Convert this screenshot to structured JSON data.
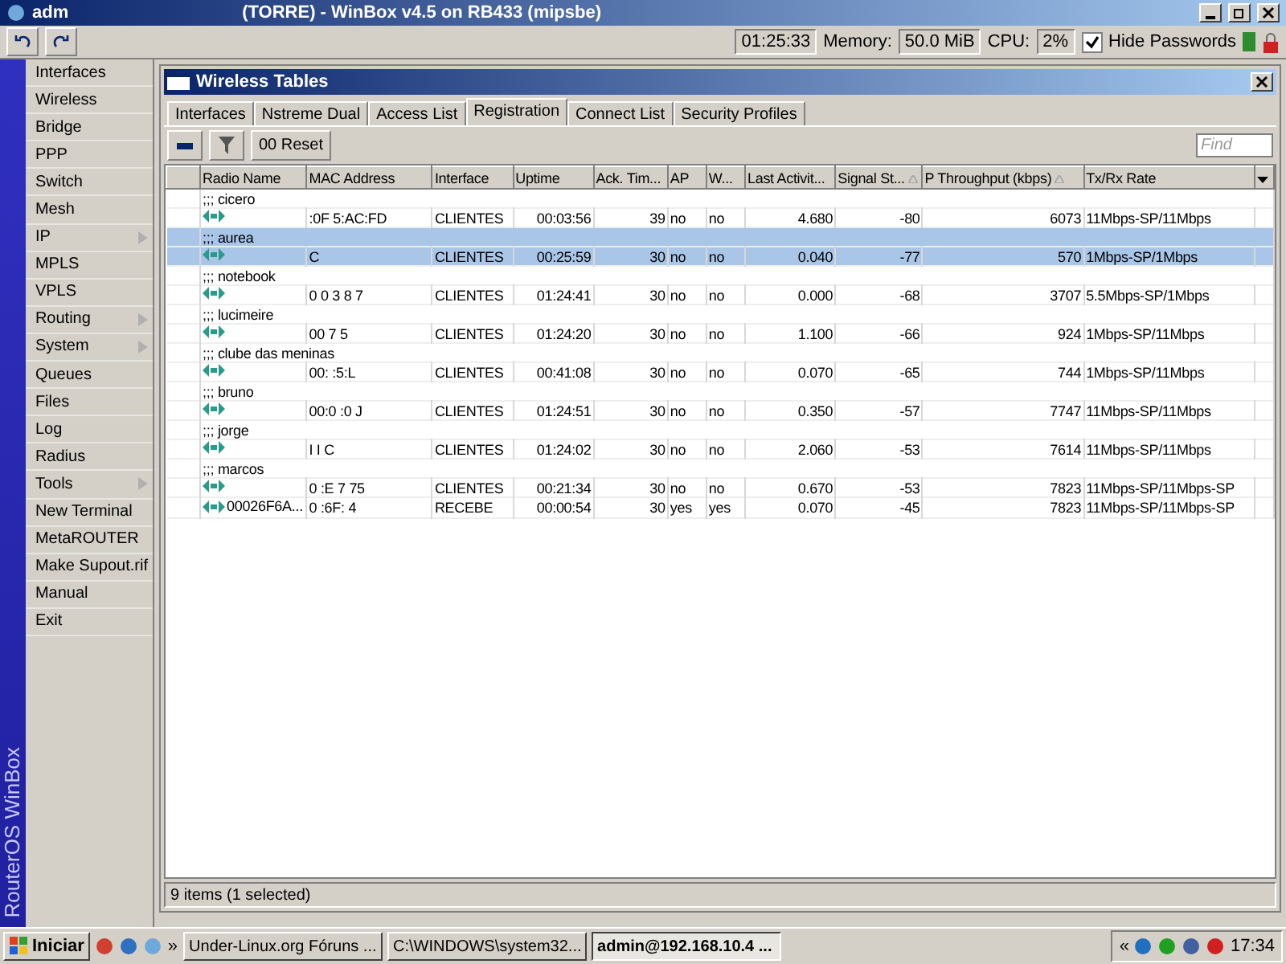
{
  "window": {
    "title_start": "adm",
    "title_end": "(TORRE) - WinBox v4.5 on RB433 (mipsbe)"
  },
  "toolbar": {
    "time": "01:25:33",
    "memory_label": "Memory:",
    "memory": "50.0 MiB",
    "cpu_label": "CPU:",
    "cpu": "2%",
    "hide_passwords": {
      "label": "Hide Passwords",
      "checked": true
    }
  },
  "sidebar": {
    "brand": "RouterOS WinBox",
    "items": [
      {
        "label": "Interfaces",
        "submenu": false
      },
      {
        "label": "Wireless",
        "submenu": false
      },
      {
        "label": "Bridge",
        "submenu": false
      },
      {
        "label": "PPP",
        "submenu": false
      },
      {
        "label": "Switch",
        "submenu": false
      },
      {
        "label": "Mesh",
        "submenu": false
      },
      {
        "label": "IP",
        "submenu": true
      },
      {
        "label": "MPLS",
        "submenu": false
      },
      {
        "label": "VPLS",
        "submenu": false
      },
      {
        "label": "Routing",
        "submenu": true
      },
      {
        "label": "System",
        "submenu": true
      },
      {
        "label": "Queues",
        "submenu": false
      },
      {
        "label": "Files",
        "submenu": false
      },
      {
        "label": "Log",
        "submenu": false
      },
      {
        "label": "Radius",
        "submenu": false
      },
      {
        "label": "Tools",
        "submenu": true
      },
      {
        "label": "New Terminal",
        "submenu": false
      },
      {
        "label": "MetaROUTER",
        "submenu": false
      },
      {
        "label": "Make Supout.rif",
        "submenu": false
      },
      {
        "label": "Manual",
        "submenu": false
      },
      {
        "label": "Exit",
        "submenu": false
      }
    ]
  },
  "panel": {
    "title": "Wireless Tables",
    "tabs": [
      {
        "label": "Interfaces",
        "selected": false
      },
      {
        "label": "Nstreme Dual",
        "selected": false
      },
      {
        "label": "Access List",
        "selected": false
      },
      {
        "label": "Registration",
        "selected": true
      },
      {
        "label": "Connect List",
        "selected": false
      },
      {
        "label": "Security Profiles",
        "selected": false
      }
    ],
    "reset_label": "00 Reset",
    "find_placeholder": "Find",
    "columns": [
      {
        "label": "Radio Name",
        "sorted": false
      },
      {
        "label": "MAC Address",
        "sorted": false
      },
      {
        "label": "Interface",
        "sorted": false
      },
      {
        "label": "Uptime",
        "sorted": false
      },
      {
        "label": "Ack. Tim...",
        "sorted": false
      },
      {
        "label": "AP",
        "sorted": false
      },
      {
        "label": "W...",
        "sorted": false
      },
      {
        "label": "Last Activit...",
        "sorted": false
      },
      {
        "label": "Signal St...",
        "sorted": true
      },
      {
        "label": "P Throughput (kbps)",
        "sorted": true
      },
      {
        "label": "Tx/Rx Rate",
        "sorted": false
      }
    ],
    "groups": [
      {
        "comment": ";;; cicero",
        "selected": false,
        "rows": [
          [
            "",
            ":0F    5:AC:FD",
            "CLIENTES",
            "00:03:56",
            "39",
            "no",
            "no",
            "4.680",
            "-80",
            "6073",
            "11Mbps-SP/11Mbps"
          ]
        ]
      },
      {
        "comment": ";;; aurea",
        "selected": true,
        "rows": [
          [
            "",
            "C",
            "CLIENTES",
            "00:25:59",
            "30",
            "no",
            "no",
            "0.040",
            "-77",
            "570",
            "1Mbps-SP/1Mbps"
          ]
        ]
      },
      {
        "comment": ";;; notebook",
        "selected": false,
        "rows": [
          [
            "",
            "0  0  3  8    7",
            "CLIENTES",
            "01:24:41",
            "30",
            "no",
            "no",
            "0.000",
            "-68",
            "3707",
            "5.5Mbps-SP/1Mbps"
          ]
        ]
      },
      {
        "comment": ";;; lucimeire",
        "selected": false,
        "rows": [
          [
            "",
            "00        7  5",
            "CLIENTES",
            "01:24:20",
            "30",
            "no",
            "no",
            "1.100",
            "-66",
            "924",
            "1Mbps-SP/11Mbps"
          ]
        ]
      },
      {
        "comment": ";;; clube das meninas",
        "selected": false,
        "rows": [
          [
            "",
            "00:     :5:L",
            "CLIENTES",
            "00:41:08",
            "30",
            "no",
            "no",
            "0.070",
            "-65",
            "744",
            "1Mbps-SP/11Mbps"
          ]
        ]
      },
      {
        "comment": ";;; bruno",
        "selected": false,
        "rows": [
          [
            "",
            "00:0     :0   J",
            "CLIENTES",
            "01:24:51",
            "30",
            "no",
            "no",
            "0.350",
            "-57",
            "7747",
            "11Mbps-SP/11Mbps"
          ]
        ]
      },
      {
        "comment": ";;; jorge",
        "selected": false,
        "rows": [
          [
            "",
            "I  I      C",
            "CLIENTES",
            "01:24:02",
            "30",
            "no",
            "no",
            "2.060",
            "-53",
            "7614",
            "11Mbps-SP/11Mbps"
          ]
        ]
      },
      {
        "comment": ";;; marcos",
        "selected": false,
        "rows": [
          [
            "",
            "0   :E  7   75",
            "CLIENTES",
            "00:21:34",
            "30",
            "no",
            "no",
            "0.670",
            "-53",
            "7823",
            "11Mbps-SP/11Mbps-SP"
          ],
          [
            "00026F6A...",
            "0   :6F:   4",
            "RECEBE",
            "00:00:54",
            "30",
            "yes",
            "yes",
            "0.070",
            "-45",
            "7823",
            "11Mbps-SP/11Mbps-SP"
          ]
        ]
      }
    ],
    "status": "9 items (1 selected)"
  },
  "taskbar": {
    "start": "Iniciar",
    "more": "»",
    "tasks": [
      {
        "label": "Under-Linux.org Fóruns ...",
        "selected": false
      },
      {
        "label": "C:\\WINDOWS\\system32...",
        "selected": false
      },
      {
        "label": "admin@192.168.10.4 ...",
        "selected": true
      }
    ],
    "tray_more": "«",
    "clock": "17:34"
  }
}
